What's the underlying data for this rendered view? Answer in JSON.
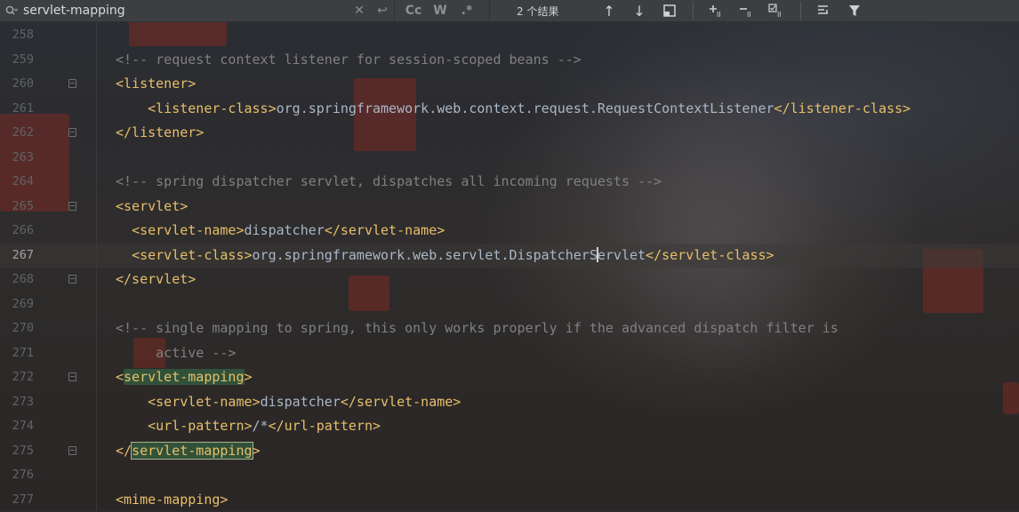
{
  "search": {
    "value": "servlet-mapping",
    "options": [
      "Cc",
      "W",
      ".*"
    ],
    "results": "2 个结果"
  },
  "lines": [
    {
      "n": "258",
      "parts": []
    },
    {
      "n": "259",
      "parts": [
        {
          "t": "<!-- request context listener for session-scoped beans -->",
          "c": "cmt"
        }
      ]
    },
    {
      "n": "260",
      "parts": [
        {
          "t": "<listener>",
          "c": "tag"
        }
      ]
    },
    {
      "n": "261",
      "parts": [
        {
          "t": "    "
        },
        {
          "t": "<listener-class>",
          "c": "tag"
        },
        {
          "t": "org.springframework.web.context.request.RequestContextListener",
          "c": "txt"
        },
        {
          "t": "</listener-class>",
          "c": "tag"
        }
      ]
    },
    {
      "n": "262",
      "parts": [
        {
          "t": "</listener>",
          "c": "tag"
        }
      ]
    },
    {
      "n": "263",
      "parts": []
    },
    {
      "n": "264",
      "parts": [
        {
          "t": "<!-- spring dispatcher servlet, dispatches all incoming requests -->",
          "c": "cmt"
        }
      ]
    },
    {
      "n": "265",
      "parts": [
        {
          "t": "<servlet>",
          "c": "tag"
        }
      ]
    },
    {
      "n": "266",
      "parts": [
        {
          "t": "  "
        },
        {
          "t": "<servlet-name>",
          "c": "tag"
        },
        {
          "t": "dispatcher",
          "c": "txt"
        },
        {
          "t": "</servlet-name>",
          "c": "tag"
        }
      ]
    },
    {
      "n": "267",
      "parts": [
        {
          "t": "  "
        },
        {
          "t": "<servlet-class>",
          "c": "tag"
        },
        {
          "t": "org.springframework.web.servlet.",
          "c": "txt"
        },
        {
          "t": "DispatcherS",
          "c": "txt"
        },
        {
          "caret": true
        },
        {
          "t": "ervlet",
          "c": "txt"
        },
        {
          "t": "</servlet-class>",
          "c": "tag"
        }
      ]
    },
    {
      "n": "268",
      "parts": [
        {
          "t": "</servlet>",
          "c": "tag"
        }
      ]
    },
    {
      "n": "269",
      "parts": []
    },
    {
      "n": "270",
      "parts": [
        {
          "t": "<!-- single mapping to spring, this only works properly if the advanced dispatch filter is",
          "c": "cmt"
        }
      ]
    },
    {
      "n": "271",
      "parts": [
        {
          "t": "     active -->",
          "c": "cmt"
        }
      ]
    },
    {
      "n": "272",
      "parts": [
        {
          "t": "<",
          "c": "tag"
        },
        {
          "t": "servlet-mapping",
          "c": "tag hl"
        },
        {
          "t": ">",
          "c": "tag"
        }
      ]
    },
    {
      "n": "273",
      "parts": [
        {
          "t": "    "
        },
        {
          "t": "<servlet-name>",
          "c": "tag"
        },
        {
          "t": "dispatcher",
          "c": "txt"
        },
        {
          "t": "</servlet-name>",
          "c": "tag"
        }
      ]
    },
    {
      "n": "274",
      "parts": [
        {
          "t": "    "
        },
        {
          "t": "<url-pattern>",
          "c": "tag"
        },
        {
          "t": "/*",
          "c": "txt"
        },
        {
          "t": "</url-pattern>",
          "c": "tag"
        }
      ]
    },
    {
      "n": "275",
      "parts": [
        {
          "t": "</",
          "c": "tag"
        },
        {
          "t": "servlet-mapping",
          "c": "tag hl-box"
        },
        {
          "t": ">",
          "c": "tag"
        }
      ]
    },
    {
      "n": "276",
      "parts": []
    },
    {
      "n": "277",
      "parts": [
        {
          "t": "<mime-mapping>",
          "c": "tag"
        }
      ]
    }
  ],
  "current_line": "267",
  "fold_markers": [
    "260",
    "262",
    "265",
    "268",
    "272",
    "275"
  ]
}
